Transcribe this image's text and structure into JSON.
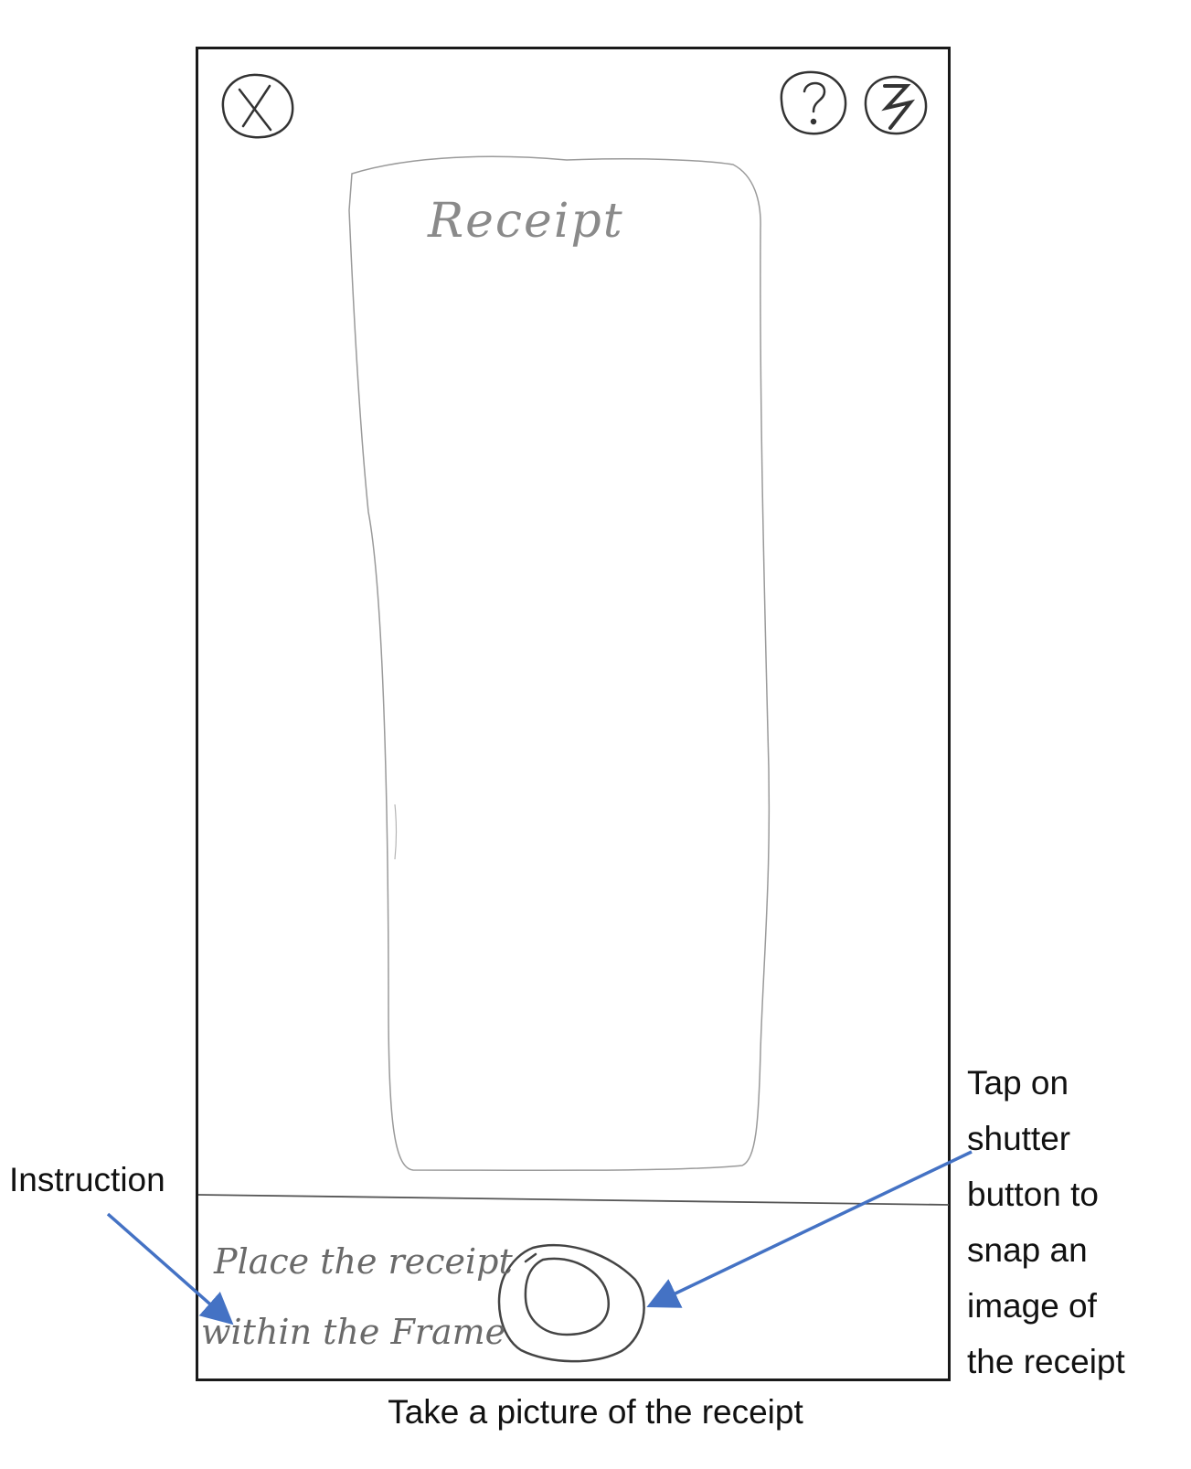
{
  "screen": {
    "receipt_label": "Receipt",
    "instruction_line1": "Place the receipt",
    "instruction_line2": "within the Frame"
  },
  "icons": {
    "close": "close-icon",
    "help": "help-icon",
    "flash": "flash-icon",
    "shutter": "shutter-icon"
  },
  "annotations": {
    "instruction": "Instruction",
    "shutter_note": [
      "Tap on",
      "shutter",
      "button to",
      "snap an",
      "image of",
      "the receipt"
    ],
    "arrow_color": "#4472c4"
  },
  "caption": "Take a picture of the receipt"
}
